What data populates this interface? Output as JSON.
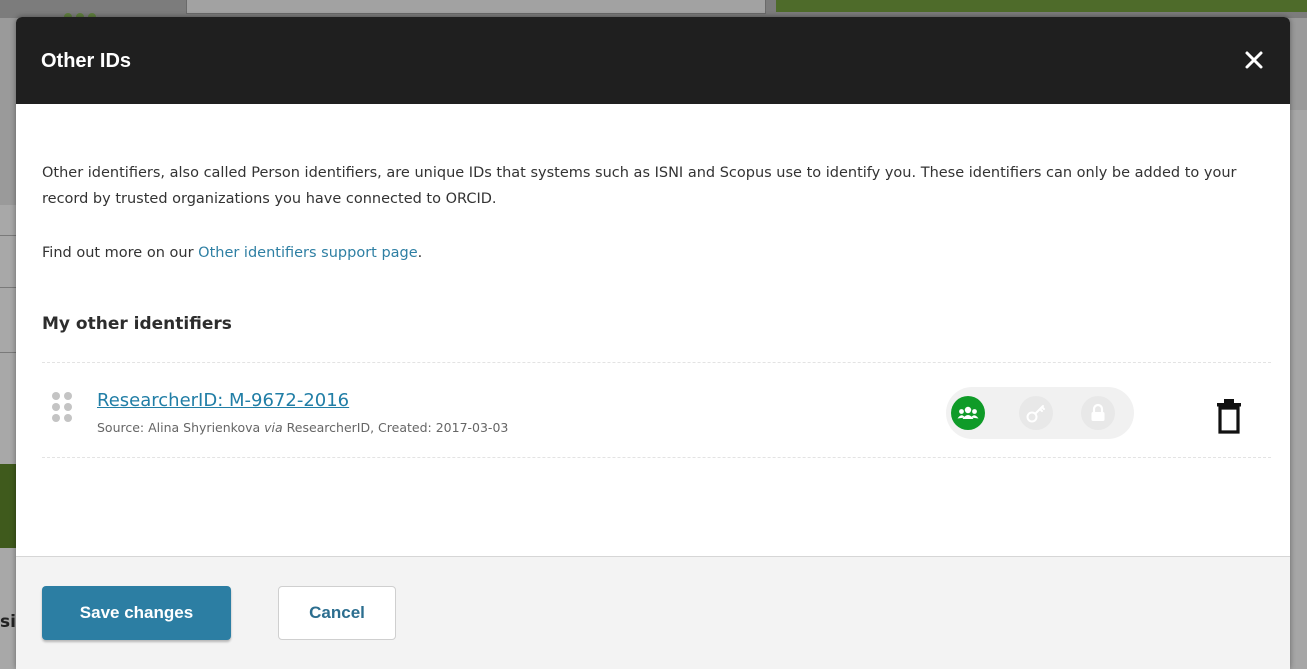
{
  "modal": {
    "title": "Other IDs",
    "description": "Other identifiers, also called Person identifiers, are unique IDs that systems such as ISNI and Scopus use to identify you. These identifiers can only be added to your record by trusted organizations you have connected to ORCID.",
    "findout_prefix": "Find out more on our ",
    "findout_link": "Other identifiers support page",
    "findout_suffix": ".",
    "section_heading": "My other identifiers",
    "identifiers": [
      {
        "name": "ResearcherID: M-9672-2016",
        "source_prefix": "Source: Alina Shyrienkova ",
        "source_via": "via",
        "source_suffix": " ResearcherID, Created: 2017-03-03",
        "visibility": "public"
      }
    ],
    "privacy_colors": {
      "public": "#0f9b28",
      "inactive": "#e8e8e8"
    },
    "save_label": "Save changes",
    "cancel_label": "Cancel"
  },
  "background": {
    "sliver_text": "si"
  }
}
